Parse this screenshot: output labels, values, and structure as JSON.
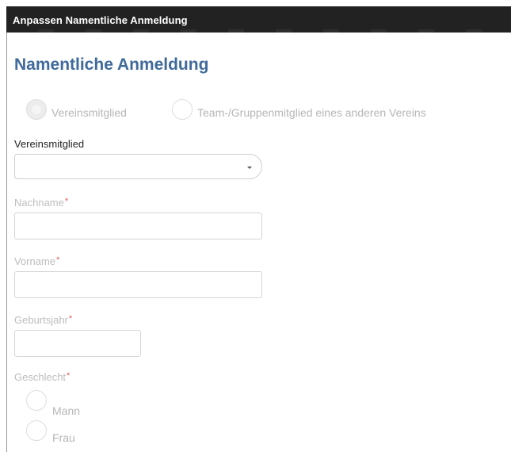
{
  "window": {
    "title": "Anpassen Namentliche Anmeldung"
  },
  "form": {
    "heading": "Namentliche Anmeldung",
    "membership_options": [
      {
        "label": "Vereinsmitglied",
        "selected": true
      },
      {
        "label": "Team-/Gruppenmitglied eines anderen Vereins",
        "selected": false
      }
    ],
    "member_select": {
      "label": "Vereinsmitglied",
      "value": ""
    },
    "fields": {
      "nachname": {
        "label": "Nachname",
        "required_mark": "*",
        "value": ""
      },
      "vorname": {
        "label": "Vorname",
        "required_mark": "*",
        "value": ""
      },
      "geburtsjahr": {
        "label": "Geburtsjahr",
        "required_mark": "*",
        "value": ""
      }
    },
    "gender": {
      "label": "Geschlecht",
      "required_mark": "*",
      "options": [
        {
          "label": "Mann",
          "selected": false
        },
        {
          "label": "Frau",
          "selected": false
        }
      ]
    }
  },
  "colors": {
    "titlebar_bg": "#222222",
    "heading": "#3f6a9b",
    "required": "#e25a5a",
    "muted_text": "#b6b6b6"
  }
}
